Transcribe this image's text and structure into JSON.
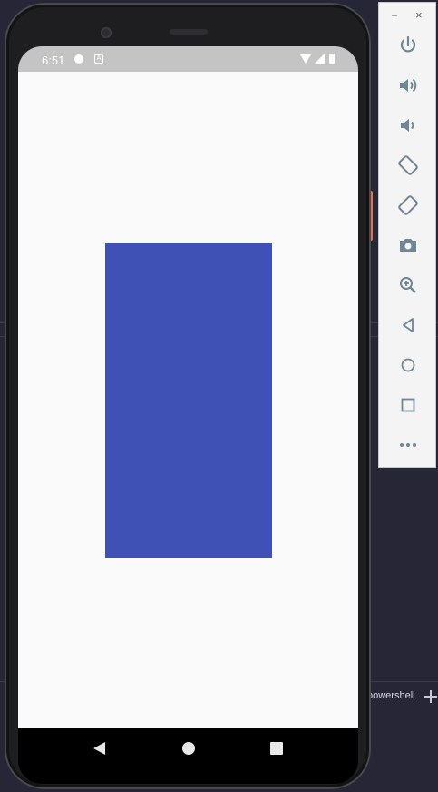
{
  "status_bar": {
    "time": "6:51"
  },
  "app": {
    "box_color": "#3f51b5",
    "background": "#fafafa"
  },
  "toolbar": {
    "window_minimize": "–",
    "window_close": "×",
    "buttons": [
      {
        "name": "power-icon"
      },
      {
        "name": "volume-up-icon"
      },
      {
        "name": "volume-down-icon"
      },
      {
        "name": "rotate-left-icon"
      },
      {
        "name": "rotate-right-icon"
      },
      {
        "name": "camera-icon"
      },
      {
        "name": "zoom-icon"
      },
      {
        "name": "back-icon"
      },
      {
        "name": "home-icon"
      },
      {
        "name": "overview-icon"
      },
      {
        "name": "more-icon"
      }
    ]
  },
  "terminal": {
    "label": "powershell"
  }
}
